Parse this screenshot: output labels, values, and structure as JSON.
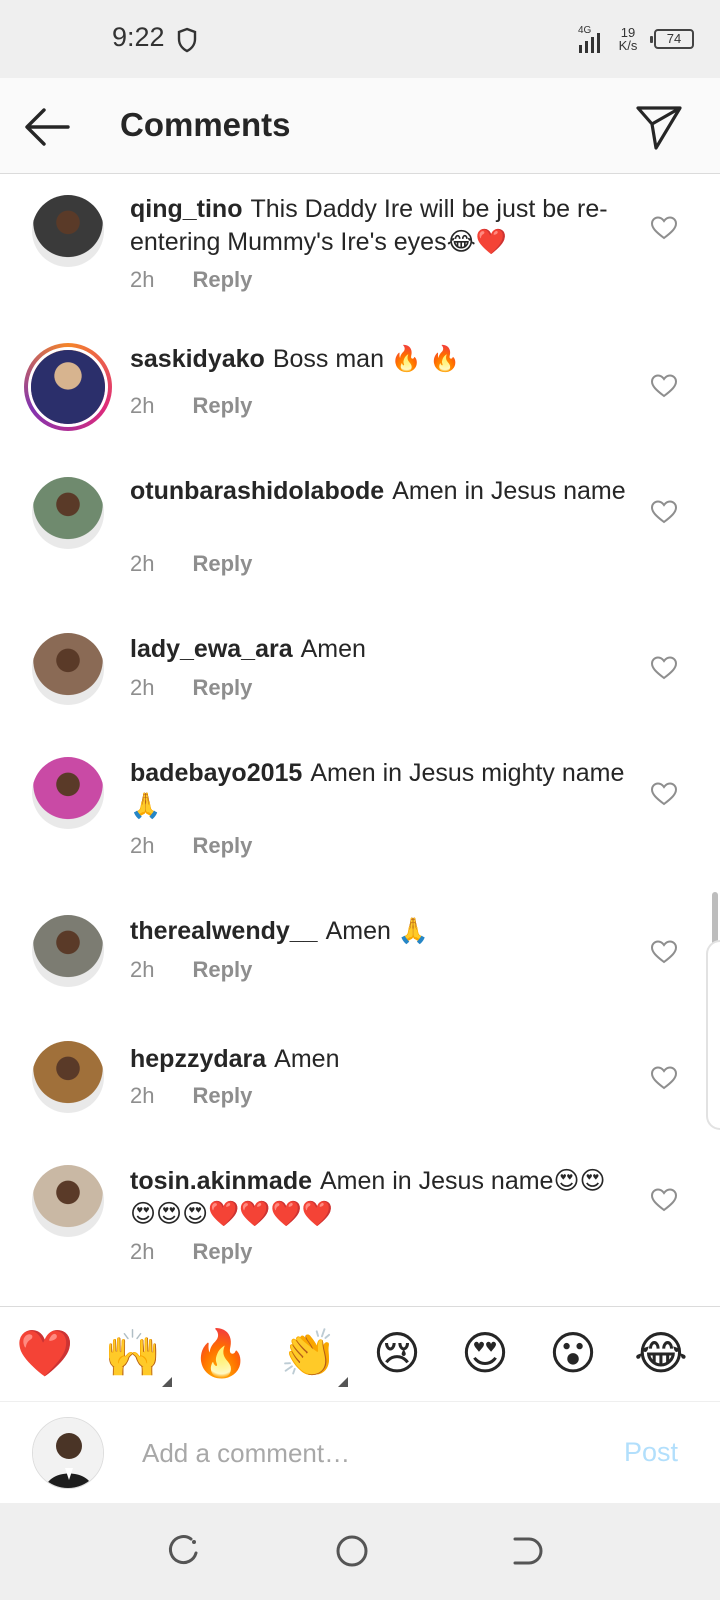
{
  "status_bar": {
    "time": "9:22",
    "network": "4G",
    "speed_value": "19",
    "speed_unit": "K/s",
    "battery": "74"
  },
  "header": {
    "title": "Comments"
  },
  "comments": [
    {
      "username": "qing_tino",
      "text": "This Daddy Ire will be just be re-entering Mummy's Ire's eyes😂❤️",
      "time": "2h",
      "reply": "Reply",
      "avatar_color": "#3a3a3a"
    },
    {
      "username": "saskidyako",
      "text": "Boss man 🔥 🔥",
      "time": "2h",
      "reply": "Reply",
      "avatar_color": "#2b2f6b"
    },
    {
      "username": "otunbarashidolabode",
      "text": "Amen in Jesus name",
      "time": "2h",
      "reply": "Reply",
      "avatar_color": "#6f8a6e"
    },
    {
      "username": "lady_ewa_ara",
      "text": "Amen",
      "time": "2h",
      "reply": "Reply",
      "avatar_color": "#8a6a55"
    },
    {
      "username": "badebayo2015",
      "text": "Amen in Jesus mighty name 🙏",
      "time": "2h",
      "reply": "Reply",
      "avatar_color": "#c94aa5"
    },
    {
      "username": "therealwendy__",
      "text": "Amen 🙏",
      "time": "2h",
      "reply": "Reply",
      "avatar_color": "#7c7c72"
    },
    {
      "username": "hepzzydara",
      "text": "Amen",
      "time": "2h",
      "reply": "Reply",
      "avatar_color": "#a0703a"
    },
    {
      "username": "tosin.akinmade",
      "text": "Amen in Jesus name😍😍😍😍😍❤️❤️❤️❤️",
      "time": "2h",
      "reply": "Reply",
      "avatar_color": "#c9b8a4"
    }
  ],
  "emoji_bar": {
    "items": [
      {
        "glyph": "❤️",
        "name": "red-heart-emoji"
      },
      {
        "glyph": "🙌",
        "name": "raising-hands-emoji"
      },
      {
        "glyph": "🔥",
        "name": "fire-emoji"
      },
      {
        "glyph": "👏",
        "name": "clapping-hands-emoji"
      },
      {
        "glyph": "😢",
        "name": "crying-face-emoji"
      },
      {
        "glyph": "😍",
        "name": "heart-eyes-emoji"
      },
      {
        "glyph": "😮",
        "name": "surprised-face-emoji"
      },
      {
        "glyph": "😂",
        "name": "tears-of-joy-emoji"
      }
    ]
  },
  "composer": {
    "placeholder": "Add a comment…",
    "post_label": "Post"
  },
  "colors": {
    "accent_disabled": "#b2dffc",
    "muted_text": "#8e8e8e",
    "story_ring": "#dd2a7b"
  }
}
